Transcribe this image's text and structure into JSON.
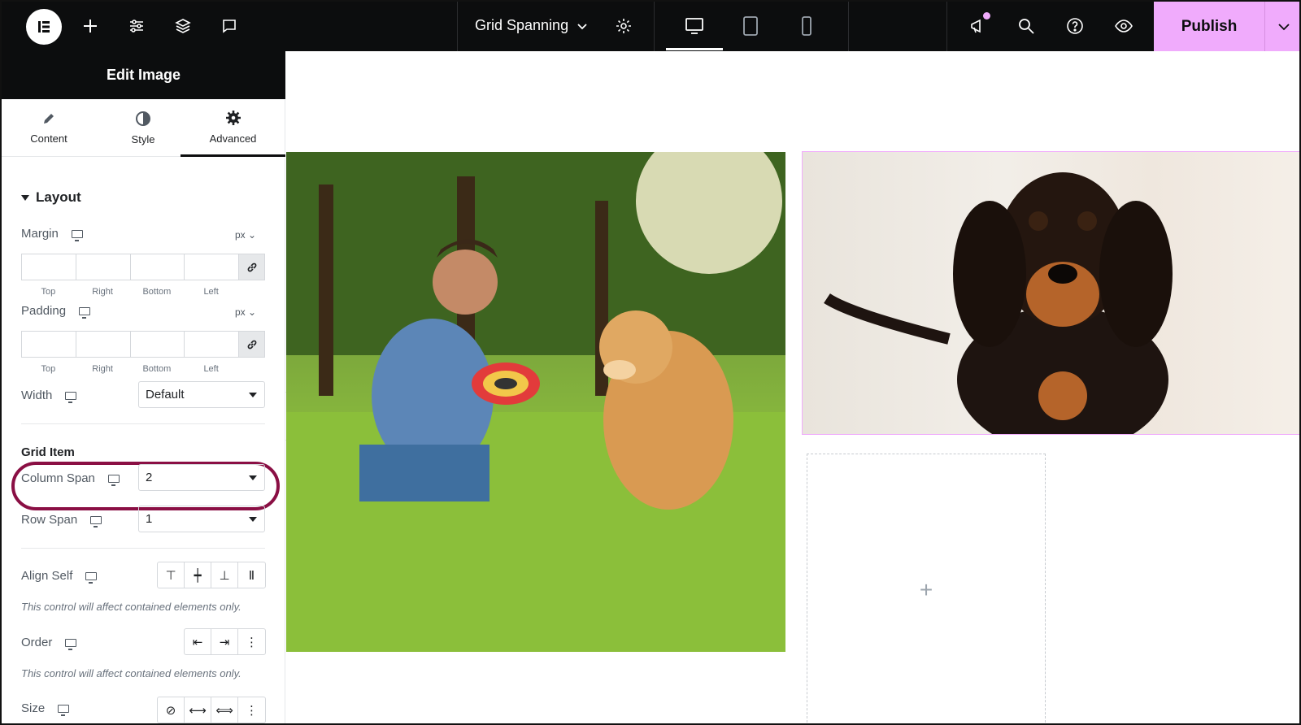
{
  "topbar": {
    "icons": [
      "elementor-logo-icon",
      "add-element-icon",
      "site-settings-icon",
      "structure-icon",
      "notes-icon"
    ],
    "document_title": "Grid Spanning",
    "publish_label": "Publish"
  },
  "panel": {
    "title": "Edit Image",
    "tabs": [
      {
        "label": "Content",
        "icon": "pencil-icon"
      },
      {
        "label": "Style",
        "icon": "contrast-icon"
      },
      {
        "label": "Advanced",
        "icon": "gear-icon",
        "active": true
      }
    ],
    "section": "Layout",
    "margin": {
      "label": "Margin",
      "unit": "px",
      "values": [
        "",
        "",
        "",
        ""
      ],
      "sides": [
        "Top",
        "Right",
        "Bottom",
        "Left"
      ]
    },
    "padding": {
      "label": "Padding",
      "unit": "px",
      "values": [
        "",
        "",
        "",
        ""
      ],
      "sides": [
        "Top",
        "Right",
        "Bottom",
        "Left"
      ]
    },
    "width": {
      "label": "Width",
      "value": "Default"
    },
    "grid_item_title": "Grid Item",
    "column_span": {
      "label": "Column Span",
      "value": "2"
    },
    "row_span": {
      "label": "Row Span",
      "value": "1"
    },
    "align_self": {
      "label": "Align Self",
      "note": "This control will affect contained elements only."
    },
    "order": {
      "label": "Order",
      "note": "This control will affect contained elements only."
    },
    "size": {
      "label": "Size"
    }
  },
  "canvas": {
    "drop_zone_icon": "+"
  }
}
